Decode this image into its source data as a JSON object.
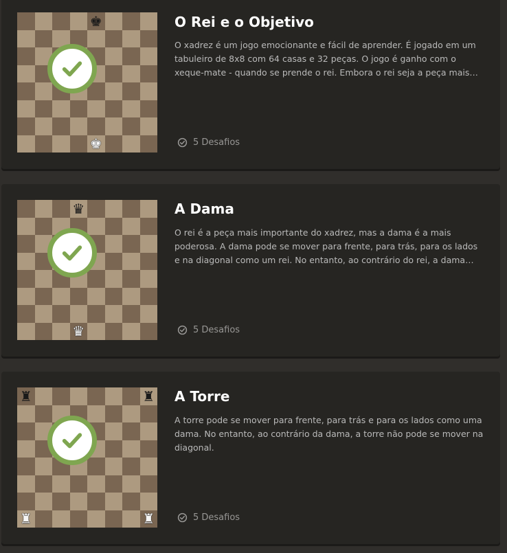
{
  "lessons": [
    {
      "title": "O Rei e o Objetivo",
      "description": "O xadrez é um jogo emocionante e fácil de aprender. É jogado em um tabuleiro de 8x8 com 64 casas e 32 peças. O jogo é ganho com o xeque-mate - quando se prende o rei. Embora o rei seja a peça mais importante do jogo, ele também é uma das mais fracas.",
      "challenges": "5 Desafios",
      "completed": true,
      "pieces": [
        {
          "square": "e8",
          "glyph": "♚",
          "color": "black"
        },
        {
          "square": "e1",
          "glyph": "♚",
          "color": "white"
        }
      ]
    },
    {
      "title": "A Dama",
      "description": "O rei é a peça mais importante do xadrez, mas a dama é a mais poderosa. A dama pode se mover para frente, para trás, para os lados e na diagonal como um rei. No entanto, ao contrário do rei, a dama pode se mover quantas casas quiser.",
      "challenges": "5 Desafios",
      "completed": true,
      "pieces": [
        {
          "square": "d8",
          "glyph": "♛",
          "color": "black"
        },
        {
          "square": "d1",
          "glyph": "♛",
          "color": "white"
        }
      ]
    },
    {
      "title": "A Torre",
      "description": "A torre pode se mover para frente, para trás e para os lados como uma dama. No entanto, ao contrário da dama, a torre não pode se mover na diagonal.",
      "challenges": "5 Desafios",
      "completed": true,
      "pieces": [
        {
          "square": "a8",
          "glyph": "♜",
          "color": "black"
        },
        {
          "square": "h8",
          "glyph": "♜",
          "color": "black"
        },
        {
          "square": "a1",
          "glyph": "♜",
          "color": "white"
        },
        {
          "square": "h1",
          "glyph": "♜",
          "color": "white"
        }
      ]
    }
  ],
  "colors": {
    "background": "#302e2b",
    "card": "#262522",
    "light_square": "#ad9a80",
    "dark_square": "#7a6652",
    "check_green": "#7fa650",
    "title": "#ffffff",
    "text": "#bababa",
    "muted": "#989795"
  },
  "icons": {
    "completed": "check-circle-icon",
    "challenges": "check-badge-icon"
  }
}
